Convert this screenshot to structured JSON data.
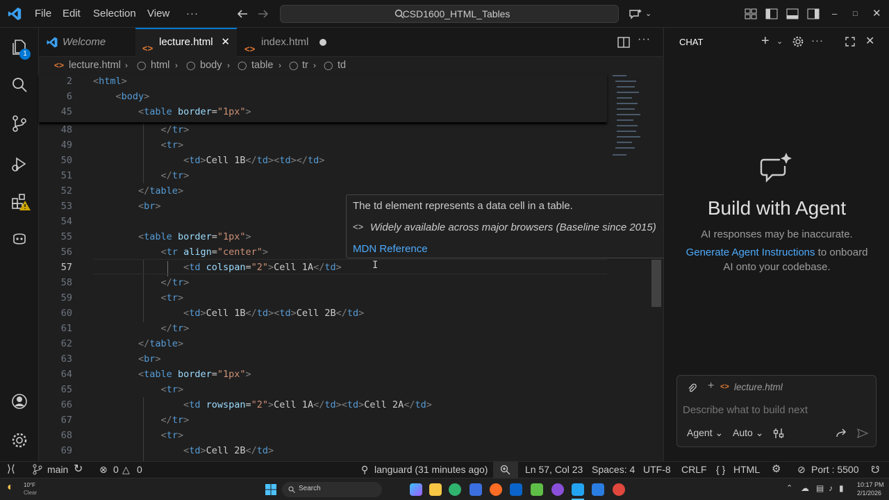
{
  "titlebar": {
    "menu": [
      "File",
      "Edit",
      "Selection",
      "View"
    ],
    "search_text": "CSD1600_HTML_Tables"
  },
  "tabs": [
    {
      "label": "Welcome",
      "state": "inactive"
    },
    {
      "label": "lecture.html",
      "state": "active"
    },
    {
      "label": "index.html",
      "state": "modified"
    }
  ],
  "breadcrumb": [
    "lecture.html",
    "html",
    "body",
    "table",
    "tr",
    "td"
  ],
  "editor": {
    "sticky_lines": [
      {
        "num": "2",
        "code": "<html>"
      },
      {
        "num": "6",
        "code": "    <body>"
      },
      {
        "num": "45",
        "code": "        <table border=\"1px\">"
      }
    ],
    "lines": [
      {
        "num": "48",
        "code": "            </tr>"
      },
      {
        "num": "49",
        "code": "            <tr>"
      },
      {
        "num": "50",
        "code": "                <td>Cell 1B</td><td></td>"
      },
      {
        "num": "51",
        "code": "            </tr>"
      },
      {
        "num": "52",
        "code": "        </table>"
      },
      {
        "num": "53",
        "code": "        <br>"
      },
      {
        "num": "54",
        "code": ""
      },
      {
        "num": "55",
        "code": "        <table border=\"1px\">"
      },
      {
        "num": "56",
        "code": "            <tr align=\"center\">"
      },
      {
        "num": "57",
        "code": "                <td colspan=\"2\">Cell 1A</td>"
      },
      {
        "num": "58",
        "code": "            </tr>"
      },
      {
        "num": "59",
        "code": "            <tr>"
      },
      {
        "num": "60",
        "code": "                <td>Cell 1B</td><td>Cell 2B</td>"
      },
      {
        "num": "61",
        "code": "            </tr>"
      },
      {
        "num": "62",
        "code": "        </table>"
      },
      {
        "num": "63",
        "code": "        <br>"
      },
      {
        "num": "64",
        "code": "        <table border=\"1px\">"
      },
      {
        "num": "65",
        "code": "            <tr>"
      },
      {
        "num": "66",
        "code": "                <td rowspan=\"2\">Cell 1A</td><td>Cell 2A</td>"
      },
      {
        "num": "67",
        "code": "            </tr>"
      },
      {
        "num": "68",
        "code": "            <tr>"
      },
      {
        "num": "69",
        "code": "                <td>Cell 2B</td>"
      }
    ],
    "current_line": "57"
  },
  "hover": {
    "description": "The td element represents a data cell in a table.",
    "baseline": "Widely available across major browsers (Baseline since 2015)",
    "link": "MDN Reference"
  },
  "chat": {
    "header": "CHAT",
    "title": "Build with Agent",
    "subtitle": "AI responses may be inaccurate.",
    "link": "Generate Agent Instructions",
    "link_rest": " to onboard",
    "line2": "AI onto your codebase.",
    "context_file": "lecture.html",
    "placeholder": "Describe what to build next",
    "mode": "Agent",
    "model": "Auto"
  },
  "status": {
    "branch": "main",
    "errors": "0",
    "warnings": "0",
    "blame": "languard (31 minutes ago)",
    "position": "Ln 57, Col 23",
    "spaces": "Spaces: 4",
    "encoding": "UTF-8",
    "eol": "CRLF",
    "language": "HTML",
    "port": "Port : 5500"
  },
  "taskbar": {
    "temp": "10°F",
    "weather": "Clear",
    "search": "Search",
    "time": "10:17 PM",
    "date": "2/1/2026"
  },
  "colors": {
    "accent": "#0078d4",
    "tag": "#569cd6",
    "attr": "#9cdcfe",
    "string": "#ce9178",
    "link": "#4daafc"
  }
}
